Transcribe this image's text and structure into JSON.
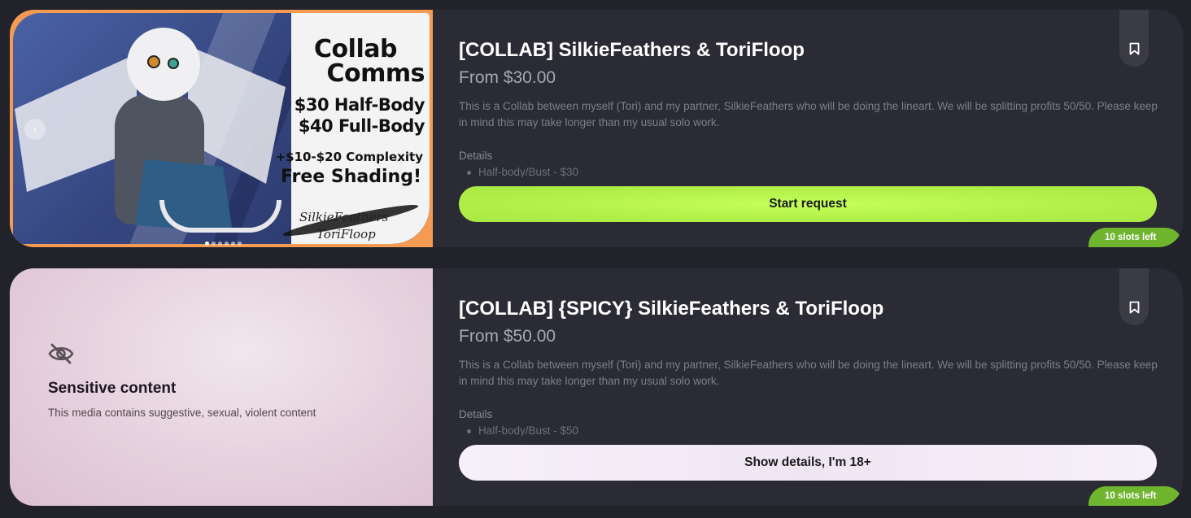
{
  "listings": [
    {
      "title": "[COLLAB] SilkieFeathers & ToriFloop",
      "price": "From $30.00",
      "description": "This is a Collab between myself (Tori) and my partner, SilkieFeathers who will be doing the lineart. We will be splitting profits 50/50. Please keep in mind this may take longer than my usual solo work.",
      "details_label": "Details",
      "details_item": "Half-body/Bust - $30",
      "cta_label": "Start request",
      "slots_badge": "10 slots left",
      "bookmark_icon": "bookmark-icon",
      "artwork_text": {
        "title_line1": "Collab",
        "title_line2": "Comms",
        "price_line1": "$30 Half-Body",
        "price_line2": "$40 Full-Body",
        "complexity": "+$10-$20 Complexity",
        "shading": "Free Shading!",
        "signature1": "SilkieFeathers",
        "signature2": "ToriFloop"
      },
      "carousel_dots": 6,
      "carousel_active": 0
    },
    {
      "title": "[COLLAB] {SPICY} SilkieFeathers & ToriFloop",
      "price": "From $50.00",
      "description": "This is a Collab between myself (Tori) and my partner, SilkieFeathers who will be doing the lineart. We will be splitting profits 50/50. Please keep in mind this may take longer than my usual solo work.",
      "details_label": "Details",
      "details_item": "Half-body/Bust - $50",
      "cta_label": "Show details, I'm 18+",
      "slots_badge": "10 slots left",
      "bookmark_icon": "bookmark-icon",
      "sensitive": {
        "icon": "eye-off-icon",
        "title": "Sensitive content",
        "subtitle": "This media contains suggestive, sexual, violent content"
      }
    }
  ],
  "colors": {
    "background": "#22222b",
    "card": "#2b2b35",
    "cta_primary": "#b2f048",
    "cta_secondary": "#f3ebf7",
    "slots_badge": "#6fb52e",
    "art_frame": "#f49a52"
  }
}
